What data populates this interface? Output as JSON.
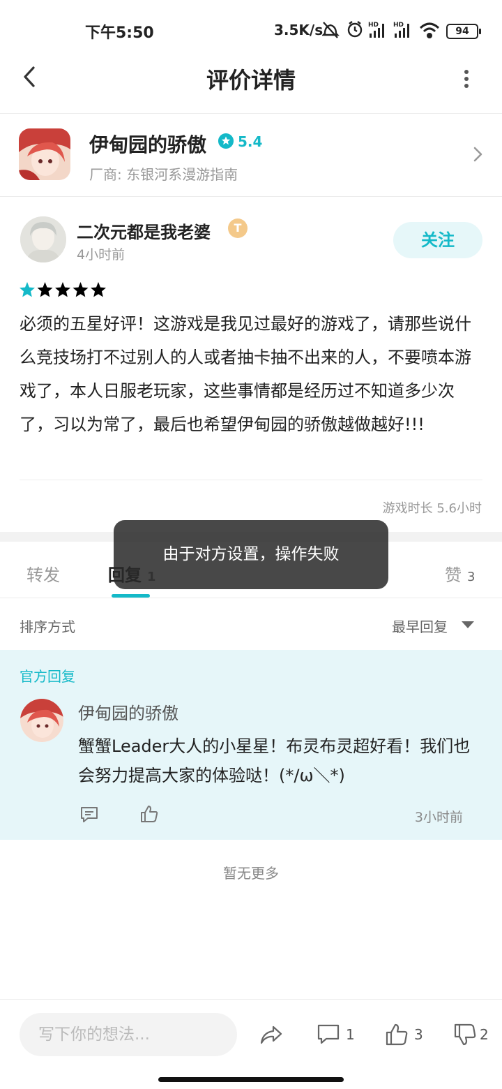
{
  "status_bar": {
    "time": "下午5:50",
    "net_speed": "3.5K/s",
    "battery": "94"
  },
  "header": {
    "title": "评价详情",
    "back_icon": "chevron-left-icon",
    "more_icon": "more-vertical-icon"
  },
  "game": {
    "name": "伊甸园的骄傲",
    "rating": "5.4",
    "vendor": "厂商: 东银河系漫游指南"
  },
  "review": {
    "username": "二次元都是我老婆",
    "badge": "T",
    "time_ago": "4小时前",
    "follow_label": "关注",
    "stars": 5,
    "text": "必须的五星好评！这游戏是我见过最好的游戏了，请那些说什么竞技场打不过别人的人或者抽卡抽不出来的人，不要喷本游戏了，本人日服老玩家，这些事情都是经历过不知道多少次了，习以为常了，最后也希望伊甸园的骄傲越做越好!!!",
    "playtime": "游戏时长 5.6小时"
  },
  "tabs": {
    "forward": "转发",
    "reply": "回复",
    "reply_count": "1",
    "like": "赞",
    "like_count": "3"
  },
  "toast": "由于对方设置，操作失败",
  "sort": {
    "label": "排序方式",
    "value": "最早回复"
  },
  "official_reply": {
    "tag": "官方回复",
    "name": "伊甸园的骄傲",
    "text": "蟹蟹Leader大人的小星星！布灵布灵超好看！我们也会努力提高大家的体验哒！(*/ω＼*)",
    "time": "3小时前"
  },
  "no_more": "暂无更多",
  "bottom_bar": {
    "input_placeholder": "写下你的想法...",
    "comment_count": "1",
    "like_count": "3",
    "dislike_count": "2"
  },
  "colors": {
    "accent": "#14b9c8",
    "reply_bg": "#e6f6f9",
    "toast_bg": "#333333"
  }
}
